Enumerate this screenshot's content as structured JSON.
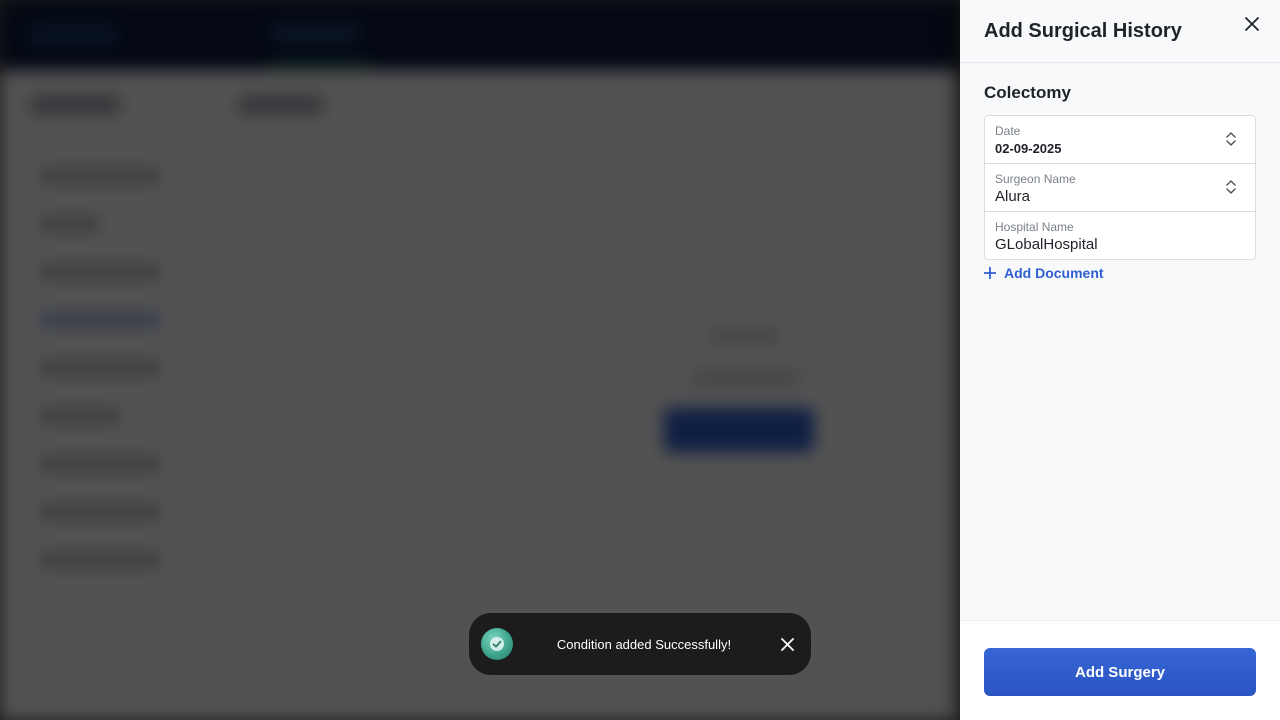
{
  "drawer": {
    "title": "Add Surgical History",
    "section_title": "Colectomy",
    "fields": [
      {
        "label": "Date",
        "value": "02-09-2025"
      },
      {
        "label": "Surgeon Name",
        "value": "Alura"
      },
      {
        "label": "Hospital Name",
        "value": "GLobalHospital"
      }
    ],
    "add_document_label": "Add Document",
    "submit_label": "Add Surgery"
  },
  "toast": {
    "message": "Condition added Successfully!"
  },
  "colors": {
    "primary": "#2f5ed1",
    "toast_bg": "#1c1c1c",
    "success": "#3da48a"
  }
}
